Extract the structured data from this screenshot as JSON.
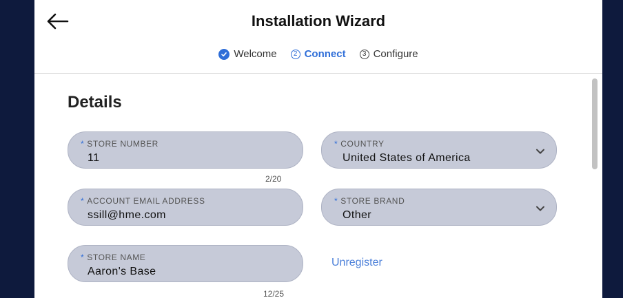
{
  "header": {
    "title": "Installation Wizard"
  },
  "steps": [
    {
      "label": "Welcome",
      "state": "completed"
    },
    {
      "label": "Connect",
      "state": "active",
      "number": "2"
    },
    {
      "label": "Configure",
      "state": "pending",
      "number": "3"
    }
  ],
  "section": {
    "title": "Details"
  },
  "fields": {
    "store_number": {
      "label": "STORE NUMBER",
      "value": "11",
      "counter": "2/20",
      "required": "*"
    },
    "country": {
      "label": "COUNTRY",
      "value": "United States of America",
      "required": "*"
    },
    "account_email": {
      "label": "ACCOUNT EMAIL ADDRESS",
      "value": "ssill@hme.com",
      "required": "*"
    },
    "store_brand": {
      "label": "STORE BRAND",
      "value": "Other",
      "required": "*"
    },
    "store_name": {
      "label": "STORE NAME",
      "value": "Aaron's Base",
      "counter": "12/25",
      "required": "*"
    }
  },
  "actions": {
    "unregister": "Unregister"
  },
  "colors": {
    "accent": "#2f6ed8",
    "frame": "#0e1a3d",
    "field_bg": "#c6cad8"
  }
}
